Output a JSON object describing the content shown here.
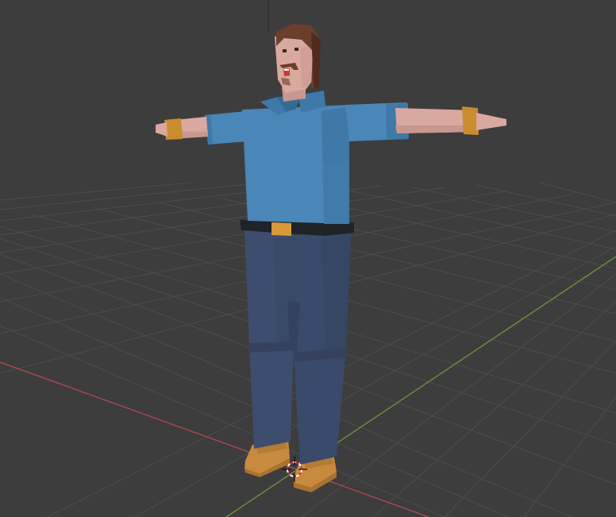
{
  "viewport": {
    "mode": "object-mode",
    "background_color": "#3d3d3d",
    "grid_line_color": "#4d4d4d",
    "x_axis_color": "#b04a55",
    "y_axis_color": "#6c9a34",
    "z_axis_color": "#333333"
  },
  "character": {
    "name": "low-poly-character",
    "pose": "t-pose",
    "colors": {
      "skin": "#d9a89f",
      "skin_shadow": "#c79790",
      "hair": "#6b3e2c",
      "hair_dark": "#4f2b1f",
      "shirt": "#4a86b7",
      "shirt_shadow": "#3f79a8",
      "shirt_dark": "#346a96",
      "pants": "#3d4d6e",
      "pants_shadow": "#34425f",
      "belt": "#1f2226",
      "buckle": "#d9993a",
      "wristband": "#c98c2e",
      "boots": "#c88a3f",
      "boots_shadow": "#a97230",
      "mouth": "#c9373b",
      "eyes": "#3b2a24"
    }
  },
  "cursor_3d": {
    "name": "3d-cursor",
    "ring_color_a": "#d42e2e",
    "ring_color_b": "#ffffff"
  }
}
